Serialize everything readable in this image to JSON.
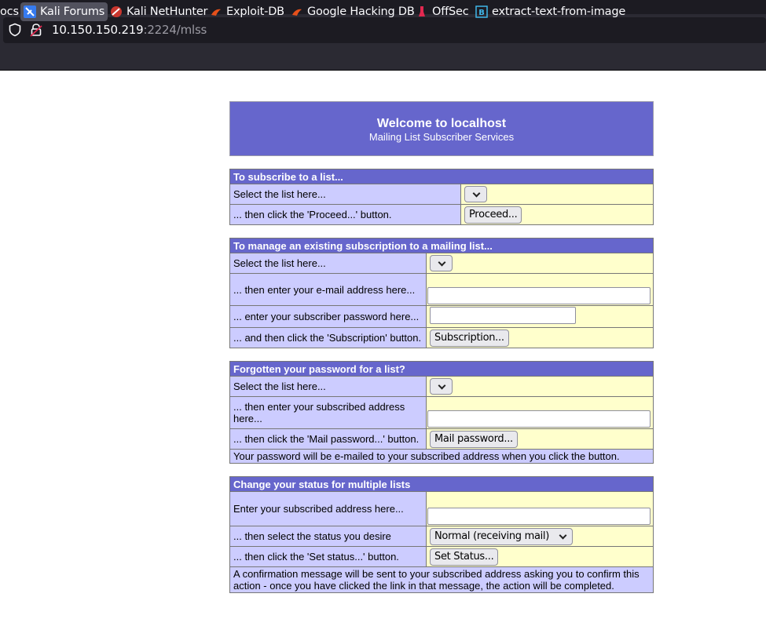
{
  "browser": {
    "url_host": "10.150.150.219",
    "url_path": ":2224/mlss",
    "bookmarks": [
      {
        "label": "ocs",
        "icon": "docs-icon"
      },
      {
        "label": "Kali Forums",
        "icon": "kali-forums-icon"
      },
      {
        "label": "Kali NetHunter",
        "icon": "kali-nethunter-icon"
      },
      {
        "label": "Exploit-DB",
        "icon": "exploit-db-icon"
      },
      {
        "label": "Google Hacking DB",
        "icon": "ghdb-icon"
      },
      {
        "label": "OffSec",
        "icon": "offsec-icon"
      },
      {
        "label": "extract-text-from-image",
        "icon": "bookmark-b-icon"
      }
    ]
  },
  "banner": {
    "title": "Welcome to localhost",
    "subtitle": "Mailing List Subscriber Services"
  },
  "subscribe": {
    "header": "To subscribe to a list...",
    "select_label": "Select the list here...",
    "proceed_label": "... then click the 'Proceed...' button.",
    "proceed_button": "Proceed..."
  },
  "manage": {
    "header": "To manage an existing subscription to a mailing list...",
    "select_label": "Select the list here...",
    "email_label": "... then enter your e-mail address here...",
    "password_label": "... enter your subscriber password here...",
    "subscription_label": "... and then click the 'Subscription' button.",
    "subscription_button": "Subscription..."
  },
  "forgot": {
    "header": "Forgotten your password for a list?",
    "select_label": "Select the list here...",
    "address_label": "... then enter your subscribed address here...",
    "mail_label": "... then click the 'Mail password...' button.",
    "mail_button": "Mail password...",
    "note": "Your password will be e-mailed to your subscribed address when you click the button."
  },
  "status": {
    "header": "Change your status for multiple lists",
    "address_label": "Enter your subscribed address here...",
    "status_label": "... then select the status you desire",
    "status_value": "Normal (receiving mail)",
    "set_label": "... then click the 'Set status...' button.",
    "set_button": "Set Status...",
    "note": "A confirmation message will be sent to your subscribed address asking you to confirm this action - once you have clicked the link in that message, the action will be completed."
  }
}
